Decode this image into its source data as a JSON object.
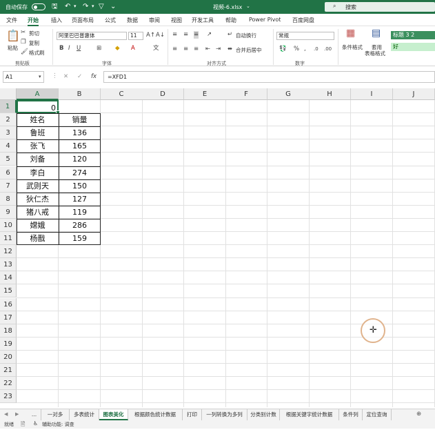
{
  "titlebar": {
    "autosave_label": "自动保存",
    "autosave_state": "关",
    "filename": "视频-6.xlsx",
    "search_placeholder": "搜索"
  },
  "menu": {
    "tabs": [
      "文件",
      "开始",
      "插入",
      "页面布局",
      "公式",
      "数据",
      "审阅",
      "视图",
      "开发工具",
      "帮助",
      "Power Pivot",
      "百度网盘"
    ],
    "active": "开始"
  },
  "ribbon": {
    "clipboard": {
      "paste": "粘贴",
      "cut": "剪切",
      "copy": "复制",
      "format_painter": "格式刷",
      "group": "剪贴板"
    },
    "font": {
      "family": "阿里巴巴普惠体",
      "size": "11",
      "group": "字体"
    },
    "alignment": {
      "wrap": "自动换行",
      "merge": "合并后居中",
      "group": "对齐方式"
    },
    "number": {
      "format": "常规",
      "group": "数字"
    },
    "styles": {
      "conditional": "条件格式",
      "table": "套用",
      "table2": "表格格式",
      "style1": "标题 3 2",
      "style2": "好"
    }
  },
  "formula_bar": {
    "name_box": "A1",
    "formula": "=XFD1"
  },
  "columns": [
    "A",
    "B",
    "C",
    "D",
    "E",
    "F",
    "G",
    "H",
    "I",
    "J"
  ],
  "rows": [
    "1",
    "2",
    "3",
    "4",
    "5",
    "6",
    "7",
    "8",
    "9",
    "10",
    "11",
    "12",
    "13",
    "14",
    "15",
    "16",
    "17",
    "18",
    "19",
    "20",
    "21",
    "22",
    "23"
  ],
  "sheet": {
    "a1_value": "0",
    "header": {
      "name": "姓名",
      "sales": "销量"
    },
    "records": [
      {
        "name": "鲁班",
        "sales": "136"
      },
      {
        "name": "张飞",
        "sales": "165"
      },
      {
        "name": "刘备",
        "sales": "120"
      },
      {
        "name": "李白",
        "sales": "274"
      },
      {
        "name": "武则天",
        "sales": "150"
      },
      {
        "name": "狄仁杰",
        "sales": "127"
      },
      {
        "name": "猪八戒",
        "sales": "119"
      },
      {
        "name": "嫦娥",
        "sales": "286"
      },
      {
        "name": "杨戬",
        "sales": "159"
      }
    ]
  },
  "sheet_tabs": {
    "ellipsis": "...",
    "tabs": [
      "一对多",
      "多表统计",
      "图表美化",
      "根据颜色统计数据",
      "打印",
      "一列转换为多列",
      "分类别计数",
      "根据关键字统计数据",
      "条件列",
      "定位查询"
    ],
    "active": "图表美化"
  },
  "status": {
    "ready": "就绪",
    "accessibility": "辅助功能: 调查"
  },
  "colors": {
    "accent": "#217346",
    "grid": "#e1e1e1"
  }
}
